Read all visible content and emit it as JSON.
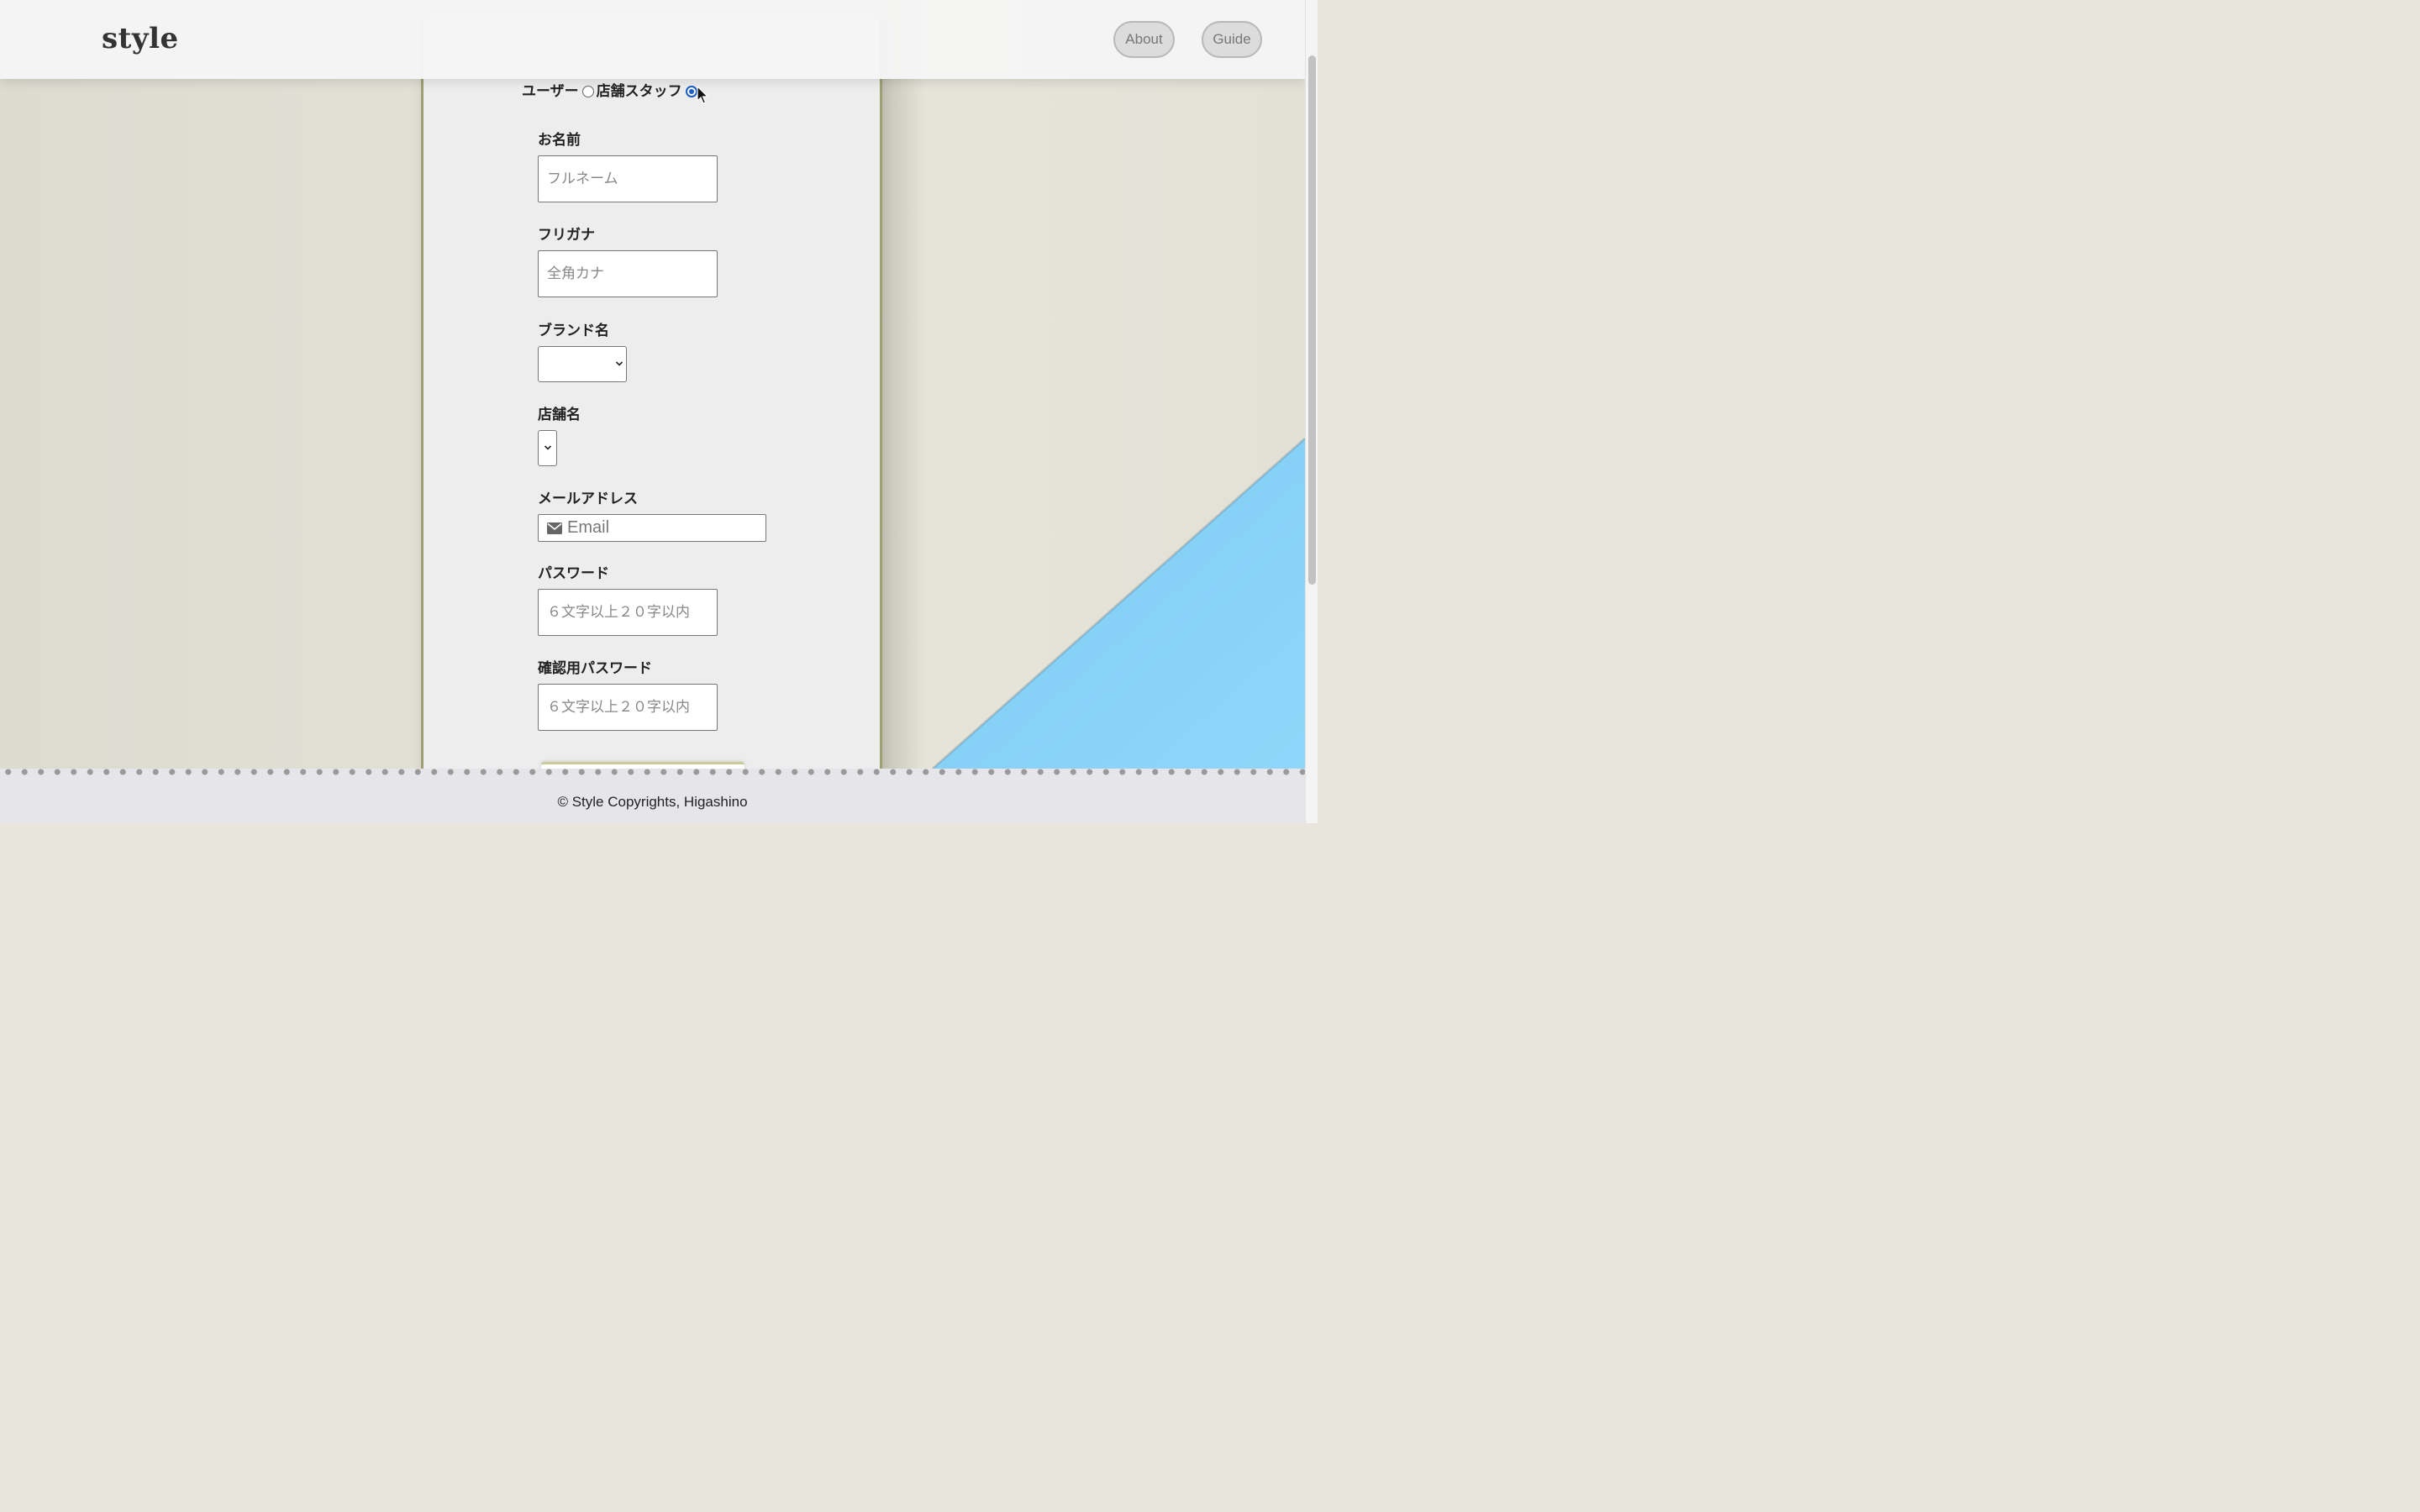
{
  "header": {
    "logo": "style",
    "nav": [
      {
        "label": "About"
      },
      {
        "label": "Guide"
      }
    ]
  },
  "form": {
    "role": {
      "options": [
        {
          "label": "ユーザー",
          "checked": false
        },
        {
          "label": "店舗スタッフ",
          "checked": true
        }
      ]
    },
    "name": {
      "label": "お名前",
      "placeholder": "フルネーム"
    },
    "furigana": {
      "label": "フリガナ",
      "placeholder": "全角カナ"
    },
    "brand": {
      "label": "ブランド名",
      "value": ""
    },
    "store": {
      "label": "店舗名",
      "value": ""
    },
    "email": {
      "label": "メールアドレス",
      "placeholder": "Email",
      "icon": "envelope-icon"
    },
    "password": {
      "label": "パスワード",
      "placeholder": "６文字以上２０字以内"
    },
    "password_confirm": {
      "label": "確認用パスワード",
      "placeholder": "６文字以上２０字以内"
    }
  },
  "footer": {
    "copyright": "© Style Copyrights, Higashino"
  },
  "colors": {
    "panel_border": "#9ea072",
    "radio_checked": "#1a5fc4",
    "sky_triangle": "#82d0f7"
  }
}
